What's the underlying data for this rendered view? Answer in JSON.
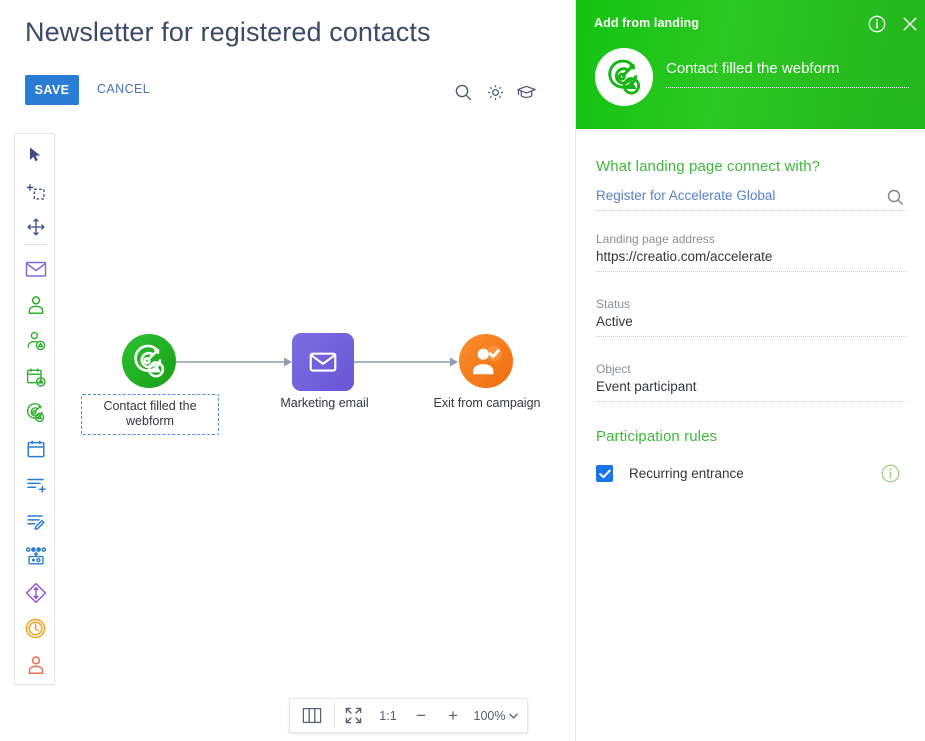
{
  "header": {
    "title": "Newsletter for registered contacts",
    "save_label": "SAVE",
    "cancel_label": "CANCEL",
    "icons": [
      "search-icon",
      "gear-icon",
      "academy-cap-icon"
    ]
  },
  "toolbar": {
    "items": [
      {
        "name": "pointer-tool",
        "icon": "cursor-arrow-icon",
        "color": "#3b4b8c"
      },
      {
        "name": "add-element-tool",
        "icon": "add-selection-icon",
        "color": "#3b4b8c"
      },
      {
        "name": "pan-tool",
        "icon": "move-cross-icon",
        "color": "#3b4b8c"
      },
      {
        "name": "marketing-email-tool",
        "icon": "envelope-icon",
        "color": "#7a6ce0"
      },
      {
        "name": "audience-tool",
        "icon": "person-icon",
        "color": "#2eae2e"
      },
      {
        "name": "add-participant-tool",
        "icon": "person-badge-icon",
        "color": "#2eae2e"
      },
      {
        "name": "event-date-tool",
        "icon": "calendar-badge-icon",
        "color": "#2eae2e"
      },
      {
        "name": "landing-tool",
        "icon": "target-icon",
        "color": "#2eae2e"
      },
      {
        "name": "calendar-tool",
        "icon": "calendar-icon",
        "color": "#2a7cd4"
      },
      {
        "name": "add-record-tool",
        "icon": "list-add-icon",
        "color": "#2a7cd4"
      },
      {
        "name": "edit-record-tool",
        "icon": "list-edit-icon",
        "color": "#2a7cd4"
      },
      {
        "name": "switch-tool",
        "icon": "router-switch-icon",
        "color": "#2a7cd4"
      },
      {
        "name": "split-flow-tool",
        "icon": "diamond-arrows-icon",
        "color": "#8e4fd0"
      },
      {
        "name": "timer-tool",
        "icon": "clock-icon",
        "color": "#f2a01e"
      },
      {
        "name": "exit-tool",
        "icon": "person-exit-icon",
        "color": "#ef6a52"
      }
    ]
  },
  "canvas": {
    "nodes": [
      {
        "id": "start",
        "label": "Contact filled the webform",
        "icon": "target-icon",
        "shape": "circle",
        "color": "#27b52d",
        "selected": true
      },
      {
        "id": "email",
        "label": "Marketing email",
        "icon": "envelope-icon",
        "shape": "rounded-square",
        "color": "#6f5dd8",
        "selected": false
      },
      {
        "id": "exit",
        "label": "Exit from campaign",
        "icon": "person-check-icon",
        "shape": "circle",
        "color": "#f57c20",
        "selected": false
      }
    ]
  },
  "zoom_toolbar": {
    "columns_icon": "columns-icon",
    "fit_icon": "fit-to-screen-icon",
    "ratio_label": "1:1",
    "minus_label": "−",
    "plus_label": "+",
    "zoom_level": "100%",
    "caret_icon": "chevron-down-icon"
  },
  "side_panel": {
    "header_title": "Add from landing",
    "info_icon": "info-circle-icon",
    "close_icon": "close-icon",
    "avatar_icon": "target-icon",
    "subject_value": "Contact filled the webform",
    "section_landing_title": "What landing page connect with?",
    "landing_value": "Register for Accelerate Global",
    "landing_search_icon": "search-icon",
    "fields": [
      {
        "label": "Landing page address",
        "value": "https://creatio.com/accelerate"
      },
      {
        "label": "Status",
        "value": "Active"
      },
      {
        "label": "Object",
        "value": "Event participant"
      }
    ],
    "section_rules_title": "Participation rules",
    "checkbox_label": "Recurring entrance",
    "checkbox_checked": true,
    "checkbox_info_icon": "info-circle-icon"
  },
  "colors": {
    "accent_blue": "#2a7cd4",
    "panel_green": "#2cc722",
    "node_green": "#27b52d",
    "node_purple": "#6f5dd8",
    "node_orange": "#f57c20"
  }
}
